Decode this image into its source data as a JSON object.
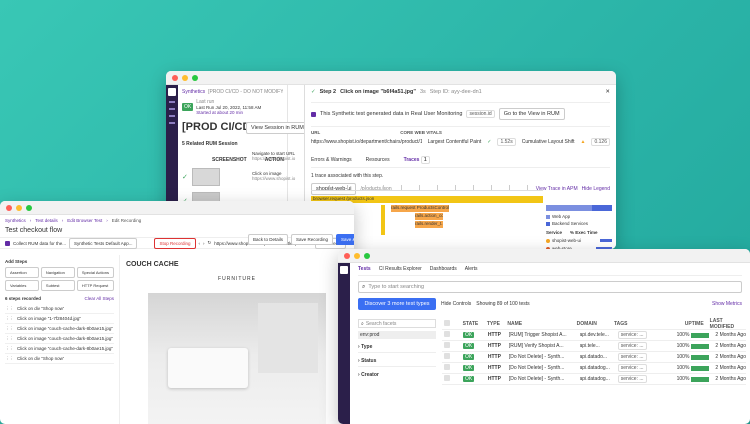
{
  "synthetics_window": {
    "breadcrumb": "Synthetics",
    "test_title": "[PROD CI/CD - DO NOT MODIFY] Shopist Ch...",
    "test_title_large": "[PROD CI/CD - DO NOT MODIFY] S",
    "status_badge": "OK",
    "last_run_label": "Last run",
    "last_run_detail": "Last Run Jul 20, 2022, 11:58 AM",
    "started_by": "Started at about 20 min",
    "rum_sessions_label": "5 Related RUM Session",
    "view_session_button": "View Session in RUM",
    "col_screenshot": "SCREENSHOT",
    "col_action": "ACTION",
    "step_action_1": "Navigate to start URL",
    "step_url_1": "https://www.shopist.io",
    "step_action_2": "Click on image",
    "step_url_2": "https://www.shopist.io",
    "step_label": "Step 2",
    "step_title": "Click on image \"b6f4a51.jpg\"",
    "step_duration": "3s",
    "step_id": "Step ID: ayy-dee-dn1",
    "rum_notice": "This Synthetic test generated data in Real User Monitoring",
    "session_id": "session.id",
    "view_in_rum": "Go to the View in RUM",
    "url_label": "URL",
    "url_value": "https://www.shopist.io/department/chairs/product/1",
    "core_web_vitals": "CORE WEB VITALS",
    "lcp_label": "Largest Contentful Paint",
    "lcp_value": "1.52s",
    "cls_label": "Cumulative Layout Shift",
    "cls_value": "0.126",
    "tabs": [
      "Errors & Warnings",
      "Resources",
      "Traces"
    ],
    "traces_count": "1",
    "trace_notice": "1 trace associated with this step.",
    "trace_service_1": "shopist-web-ui",
    "trace_service_2": "/products.json",
    "view_trace": "View Trace in APM",
    "hide_legend": "Hide Legend",
    "span_main": "browser.request /products.json",
    "span_2": "rails.request ProductsController",
    "span_3": "rails.action_co...",
    "span_4": "rails.render_t...",
    "legend": {
      "items": [
        {
          "name": "Web App",
          "color": "#7b8fe0"
        },
        {
          "name": "Backend Services",
          "color": "#4a67d8"
        }
      ],
      "header_service": "Service",
      "header_exec": "% Exec Time",
      "services": [
        {
          "name": "shopist-web-ui",
          "pct": "",
          "color": "#f5a623"
        },
        {
          "name": "web-store",
          "pct": "",
          "color": "#e05c2c"
        },
        {
          "name": "web-store-mongo",
          "pct": "",
          "color": "#6c3fc9"
        }
      ]
    }
  },
  "browser_test_window": {
    "breadcrumb": [
      "Synthetics",
      "Test details",
      "Edit Browser Test",
      "Edit Recording"
    ],
    "title": "Test checkout flow",
    "collect_rum": "Collect RUM data for the...",
    "rum_app": "Synthetic Tests Default App...",
    "stop_recording": "Stop Recording",
    "url": "https://www.shopist.io/department/outlet/product/11",
    "screen": "Fit Screen",
    "back_button": "Back to Details",
    "save_recording": "Save Recording",
    "save_launch": "Save & Launch",
    "add_steps_label": "Add Steps",
    "step_types": [
      "Assertion",
      "Navigation",
      "Special Actions",
      "Variables",
      "Subtest",
      "HTTP Request"
    ],
    "steps_recorded": "6 steps recorded",
    "clear_all": "Clear All Steps",
    "steps": [
      "Click on div \"Shop now\"",
      "Click on image \"1-7f28404d.jpg\"",
      "Click on image \"couch-cache-dark-8b0ae15.jpg\"",
      "Click on image \"couch-cache-dark-8b0ae15.jpg\"",
      "Click on image \"couch-cache-dark-8b0ae15.jpg\"",
      "Click on div \"Shop now\""
    ],
    "brand": "COUCH CACHE",
    "section": "FURNITURE"
  },
  "tests_window": {
    "tabs": [
      "Tests",
      "CI Results Explorer",
      "Dashboards",
      "Alerts"
    ],
    "search_placeholder": "Type to start searching",
    "discover_button": "Discover 3 more test types",
    "hide_controls": "Hide Controls",
    "showing": "Showing 89 of 100 tests",
    "show_metrics": "Show Metrics",
    "search_facets": "Search facets",
    "facet_env": "env:prod",
    "facets": [
      "Type",
      "Status",
      "Creator"
    ],
    "columns": [
      "STATE",
      "TYPE",
      "NAME",
      "DOMAIN",
      "TAGS",
      "UPTIME",
      "LAST MODIFIED"
    ],
    "rows": [
      {
        "state": "OK",
        "type": "HTTP",
        "name": "[RUM] Trigger Shopist A...",
        "domain": "api.dev.tele...",
        "tag": "service: ...",
        "uptime": "100%",
        "uptime_fraction": 1.0,
        "modified": "2 Months Ago"
      },
      {
        "state": "OK",
        "type": "HTTP",
        "name": "[RUM] Verify Shopist A...",
        "domain": "api.tele...",
        "tag": "service: ...",
        "uptime": "100%",
        "uptime_fraction": 1.0,
        "modified": "2 Months Ago"
      },
      {
        "state": "OK",
        "type": "HTTP",
        "name": "[Do Not Delete] - Synth...",
        "domain": "api.datado...",
        "tag": "service: ...",
        "uptime": "100%",
        "uptime_fraction": 1.0,
        "modified": "2 Months Ago"
      },
      {
        "state": "OK",
        "type": "HTTP",
        "name": "[Do Not Delete] - Synth...",
        "domain": "api.datadog...",
        "tag": "service: ...",
        "uptime": "100%",
        "uptime_fraction": 1.0,
        "modified": "2 Months Ago"
      },
      {
        "state": "OK",
        "type": "HTTP",
        "name": "[Do Not Delete] - Synth...",
        "domain": "api.datadog...",
        "tag": "service: ...",
        "uptime": "100%",
        "uptime_fraction": 1.0,
        "modified": "2 Months Ago"
      }
    ]
  }
}
